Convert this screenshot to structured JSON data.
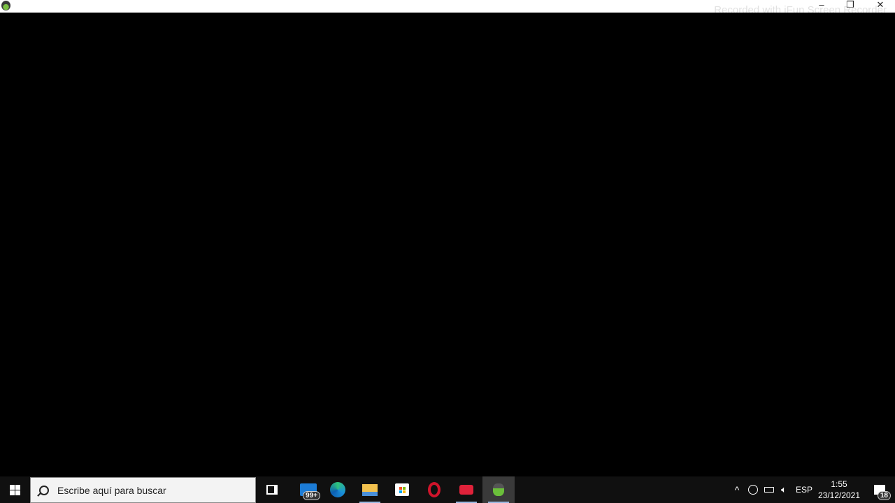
{
  "window": {
    "watermark": "Recorded with iFun Screen Recorder",
    "minimize": "–",
    "restore": "❐",
    "close": "✕"
  },
  "taskbar": {
    "search_placeholder": "Escribe aquí para buscar",
    "mail_badge": "99+",
    "apps": [
      "task-view",
      "mail",
      "edge",
      "file-explorer",
      "store",
      "opera",
      "screen-recorder",
      "active-app"
    ],
    "tray": {
      "chevron": "^",
      "language": "ESP",
      "time": "1:55",
      "date": "23/12/2021",
      "notifications": "18"
    }
  }
}
